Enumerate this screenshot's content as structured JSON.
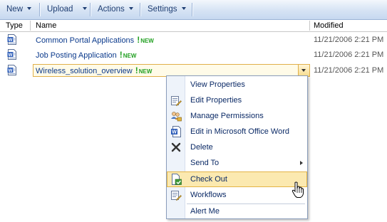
{
  "toolbar": {
    "new_label": "New",
    "upload_label": "Upload",
    "actions_label": "Actions",
    "settings_label": "Settings"
  },
  "columns": {
    "type": "Type",
    "name": "Name",
    "modified": "Modified"
  },
  "rows": [
    {
      "name": "Common Portal Applications",
      "new_flag": "!",
      "new_text": "NEW",
      "modified": "11/21/2006 2:21 PM"
    },
    {
      "name": "Job Posting Application",
      "new_flag": "!",
      "new_text": "NEW",
      "modified": "11/21/2006 2:21 PM"
    },
    {
      "name": "Wireless_solution_overview",
      "new_flag": "!",
      "new_text": "NEW",
      "modified": "11/21/2006 2:21 PM"
    }
  ],
  "context_menu": {
    "items": [
      {
        "label": "View Properties",
        "icon": "none"
      },
      {
        "label": "Edit Properties",
        "icon": "edit-properties-icon"
      },
      {
        "label": "Manage Permissions",
        "icon": "manage-permissions-icon"
      },
      {
        "label": "Edit in Microsoft Office Word",
        "icon": "word-document-icon"
      },
      {
        "label": "Delete",
        "icon": "delete-x-icon"
      },
      {
        "label": "Send To",
        "icon": "none",
        "submenu": true
      },
      {
        "label": "Check Out",
        "icon": "check-out-icon",
        "highlighted": true
      },
      {
        "label": "Workflows",
        "icon": "workflows-icon"
      },
      {
        "label": "Alert Me",
        "icon": "none"
      }
    ]
  },
  "colors": {
    "toolbar_text": "#1f3e72",
    "link": "#0b3a8c",
    "new_green": "#22a022",
    "highlight": "#fbe9b0"
  }
}
